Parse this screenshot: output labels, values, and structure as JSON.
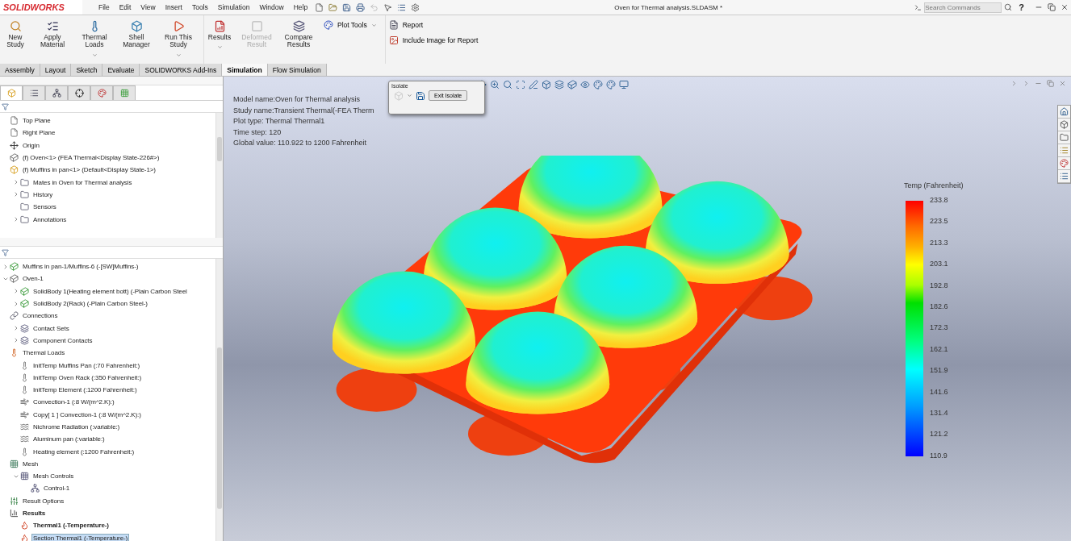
{
  "app": {
    "logo": "SOLIDWORKS",
    "menu": [
      "File",
      "Edit",
      "View",
      "Insert",
      "Tools",
      "Simulation",
      "Window",
      "Help"
    ],
    "document_title": "Oven for Thermal analysis.SLDASM *",
    "search": {
      "placeholder": "Search Commands"
    },
    "help": "?"
  },
  "ribbon": {
    "groups": [
      {
        "commands": [
          {
            "label": "New Study",
            "kind": "new-study",
            "disabled": false,
            "dropdown": false
          },
          {
            "label": "Apply Material",
            "kind": "material",
            "disabled": false,
            "dropdown": false
          },
          {
            "label": "Thermal Loads",
            "kind": "loads",
            "disabled": false,
            "dropdown": true
          },
          {
            "label": "Shell Manager",
            "kind": "shell",
            "disabled": false,
            "dropdown": false
          },
          {
            "label": "Run This Study",
            "kind": "run",
            "disabled": false,
            "dropdown": true
          }
        ]
      },
      {
        "commands": [
          {
            "label": "Results",
            "kind": "results",
            "disabled": false,
            "dropdown": true
          },
          {
            "label": "Deformed Result",
            "kind": "deformed",
            "disabled": true,
            "dropdown": false
          },
          {
            "label": "Compare Results",
            "kind": "compare",
            "disabled": false,
            "dropdown": false
          }
        ],
        "small": [
          {
            "label": "Plot Tools",
            "kind": "plot",
            "dropdown": true
          }
        ]
      },
      {
        "small": [
          {
            "label": "Report",
            "kind": "report",
            "dropdown": false
          },
          {
            "label": "Include Image for Report",
            "kind": "image",
            "dropdown": false
          }
        ]
      }
    ]
  },
  "tabs": [
    {
      "label": "Assembly",
      "selected": false
    },
    {
      "label": "Layout",
      "selected": false
    },
    {
      "label": "Sketch",
      "selected": false
    },
    {
      "label": "Evaluate",
      "selected": false
    },
    {
      "label": "SOLIDWORKS Add-Ins",
      "selected": false
    },
    {
      "label": "Simulation",
      "selected": true
    },
    {
      "label": "Flow Simulation",
      "selected": false
    }
  ],
  "manager_tabs": [
    {
      "kind": "features",
      "selected": true
    },
    {
      "kind": "properties",
      "selected": false
    },
    {
      "kind": "configurations",
      "selected": false
    },
    {
      "kind": "dimxpert",
      "selected": false
    },
    {
      "kind": "display",
      "selected": false
    },
    {
      "kind": "simulation",
      "selected": false
    }
  ],
  "feature_tree": [
    {
      "label": "Top Plane",
      "kind": "plane"
    },
    {
      "label": "Right Plane",
      "kind": "plane"
    },
    {
      "label": "Origin",
      "kind": "origin"
    },
    {
      "label": "(f) Oven<1> (FEA Thermal<Display State-226#>)",
      "kind": "part"
    },
    {
      "label": "(f) Muffins in pan<1> (Default<Display State-1>)",
      "kind": "assembly",
      "children": [
        {
          "label": "Mates in Oven for Thermal analysis",
          "kind": "folder",
          "expanded": false
        },
        {
          "label": "History",
          "kind": "folder",
          "expanded": false
        },
        {
          "label": "Sensors",
          "kind": "folder"
        },
        {
          "label": "Annotations",
          "kind": "folder",
          "expanded": false
        }
      ]
    }
  ],
  "study_tree": [
    {
      "label": "Muffins in pan-1/Muffins-6 (-[SW]Muffins-)",
      "kind": "body",
      "expanded": false
    },
    {
      "label": "Oven-1",
      "kind": "part",
      "expanded": true,
      "children": [
        {
          "label": "SolidBody 1(Heating element bott) (-Plain Carbon Steel",
          "kind": "body",
          "expanded": false
        },
        {
          "label": "SolidBody 2(Rack) (-Plain Carbon Steel-)",
          "kind": "body",
          "expanded": false
        }
      ]
    },
    {
      "label": "Connections",
      "kind": "connections",
      "children": [
        {
          "label": "Contact Sets",
          "kind": "contact",
          "expanded": false
        },
        {
          "label": "Component Contacts",
          "kind": "contact",
          "expanded": false
        }
      ]
    },
    {
      "label": "Thermal Loads",
      "kind": "loads",
      "children": [
        {
          "label": "InitTemp Muffins Pan (:70 Fahrenheit:)",
          "kind": "temperature"
        },
        {
          "label": "InitTemp Oven Rack (:350 Fahrenheit:)",
          "kind": "temperature"
        },
        {
          "label": "InitTemp Element (:1200 Fahrenheit:)",
          "kind": "temperature"
        },
        {
          "label": "Convection-1 (:8 W/(m^2.K):)",
          "kind": "convection"
        },
        {
          "label": "Copy[ 1 ] Convection-1 (:8 W/(m^2.K):)",
          "kind": "convection"
        },
        {
          "label": "Nichrome Radiation (:variable:)",
          "kind": "radiation"
        },
        {
          "label": "Aluminum pan (:variable:)",
          "kind": "radiation"
        },
        {
          "label": "Heating element (:1200 Fahrenheit:)",
          "kind": "temperature"
        }
      ]
    },
    {
      "label": "Mesh",
      "kind": "mesh",
      "children": [
        {
          "label": "Mesh Controls",
          "kind": "mesh-control",
          "expanded": true,
          "children": [
            {
              "label": "Control-1",
              "kind": "control"
            }
          ]
        }
      ]
    },
    {
      "label": "Result Options",
      "kind": "options"
    },
    {
      "label": "Results",
      "kind": "results",
      "bold": true,
      "children": [
        {
          "label": "Thermal1 (-Temperature-)",
          "kind": "plot",
          "bold": true,
          "selected": false
        },
        {
          "label": "Section Thermal1 (-Temperature-)",
          "kind": "plot",
          "selected": true
        }
      ]
    }
  ],
  "viewport": {
    "info": [
      "Model name:Oven for Thermal analysis",
      "Study name:Transient Thermal(-FEA Therm",
      "Plot type: Thermal Thermal1",
      "Time step: 120",
      "Global value: 110.922 to 1200 Fahrenheit"
    ],
    "isolate": {
      "title": "Isolate",
      "button": "Exit Isolate"
    },
    "legend": {
      "title": "Temp (Fahrenheit)",
      "labels": [
        "233.8",
        "223.5",
        "213.3",
        "203.1",
        "192.8",
        "182.6",
        "172.3",
        "162.1",
        "151.9",
        "141.6",
        "131.4",
        "121.2",
        "110.9"
      ]
    }
  }
}
